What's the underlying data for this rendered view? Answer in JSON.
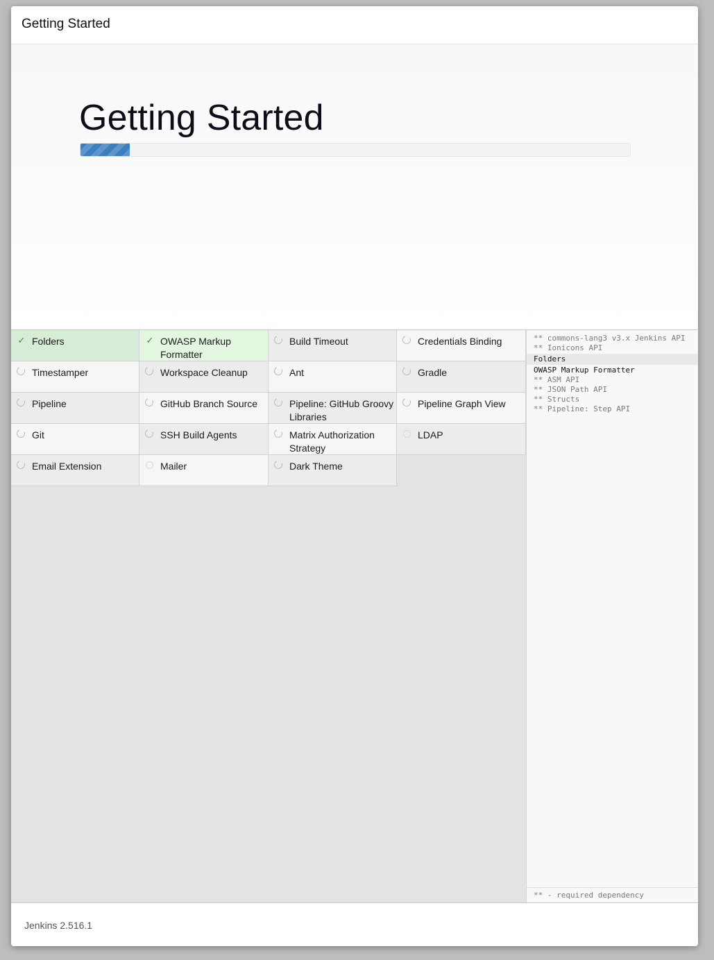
{
  "dialog": {
    "title": "Getting Started"
  },
  "hero": {
    "title": "Getting Started",
    "progress": 0.09,
    "progress_color": "#3a7fc0"
  },
  "plugins": [
    {
      "label": "Folders",
      "status": "success"
    },
    {
      "label": "OWASP Markup Formatter",
      "status": "success"
    },
    {
      "label": "Build Timeout",
      "status": "installing"
    },
    {
      "label": "Credentials Binding",
      "status": "installing"
    },
    {
      "label": "Timestamper",
      "status": "installing"
    },
    {
      "label": "Workspace Cleanup",
      "status": "installing"
    },
    {
      "label": "Ant",
      "status": "installing"
    },
    {
      "label": "Gradle",
      "status": "installing"
    },
    {
      "label": "Pipeline",
      "status": "installing"
    },
    {
      "label": "GitHub Branch Source",
      "status": "installing"
    },
    {
      "label": "Pipeline: GitHub Groovy Libraries",
      "status": "installing"
    },
    {
      "label": "Pipeline Graph View",
      "status": "installing"
    },
    {
      "label": "Git",
      "status": "installing"
    },
    {
      "label": "SSH Build Agents",
      "status": "installing"
    },
    {
      "label": "Matrix Authorization Strategy",
      "status": "installing"
    },
    {
      "label": "LDAP",
      "status": "pending"
    },
    {
      "label": "Email Extension",
      "status": "installing"
    },
    {
      "label": "Mailer",
      "status": "pending"
    },
    {
      "label": "Dark Theme",
      "status": "installing"
    }
  ],
  "install_log": {
    "lines": [
      {
        "text": "** commons-lang3 v3.x Jenkins API",
        "state": "dependency"
      },
      {
        "text": "** Ionicons API",
        "state": "dependency"
      },
      {
        "text": "Folders",
        "state": "current"
      },
      {
        "text": "OWASP Markup Formatter",
        "state": "done"
      },
      {
        "text": "** ASM API",
        "state": "dependency"
      },
      {
        "text": "** JSON Path API",
        "state": "dependency"
      },
      {
        "text": "** Structs",
        "state": "dependency"
      },
      {
        "text": "** Pipeline: Step API",
        "state": "dependency"
      }
    ],
    "footer": "** - required dependency"
  },
  "footer": {
    "version": "Jenkins 2.516.1"
  }
}
